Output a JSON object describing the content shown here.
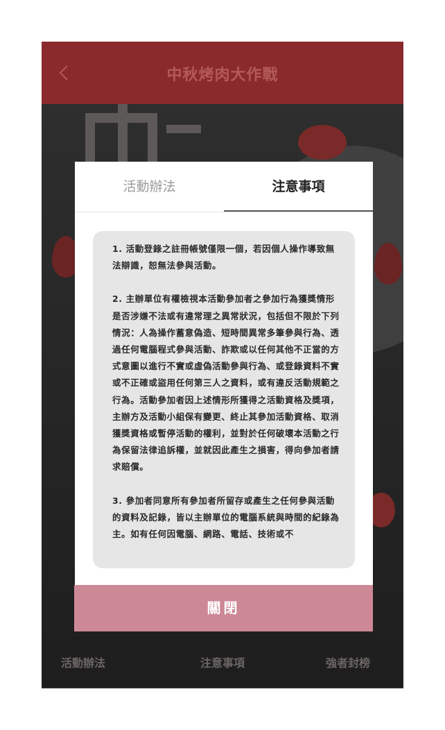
{
  "header": {
    "title": "中秋烤肉大作戰",
    "back_icon": "chevron-left-icon"
  },
  "bottom_nav": {
    "items": [
      {
        "label": "活動辦法",
        "icon": "meat-icon"
      },
      {
        "label": "注意事項",
        "icon": "grill-icon"
      },
      {
        "label": "強者封榜",
        "icon": "rocket-icon"
      }
    ]
  },
  "modal": {
    "tabs": [
      {
        "label": "活動辦法",
        "active": false
      },
      {
        "label": "注意事項",
        "active": true
      }
    ],
    "paragraphs": [
      "1.  活動登錄之註冊帳號僅限一個，若因個人操作導致無法辯識，恕無法參與活動。",
      "2.  主辦單位有權檢視本活動參加者之參加行為獲獎情形是否涉嫌不法或有違常理之異常狀況，包括但不限於下列情況：人為操作蓄意偽造、短時間異常多筆參與行為、透過任何電腦程式參與活動、詐欺或以任何其他不正當的方式意圖以進行不實或虛偽活動參與行為、或登錄資料不實或不正確或盜用任何第三人之資料，或有違反活動規範之行為。活動參加者因上述情形所獲得之活動資格及獎項，主辦方及活動小組保有變更、終止其參加活動資格、取消獲獎資格或暫停活動的權利，並對於任何破壞本活動之行為保留法律追訴權，並就因此產生之損害，得向參加者請求賠償。",
      "3.  參加者同意所有參加者所留存或產生之任何參與活動的資料及記錄，皆以主辦單位的電腦系統與時間的紀錄為主。如有任何因電腦、網路、電話、技術或不"
    ],
    "close_label": "關閉"
  },
  "colors": {
    "topbar": "#8a2a2c",
    "close_button": "#cd8896",
    "content_bg": "#e6e6e6"
  }
}
